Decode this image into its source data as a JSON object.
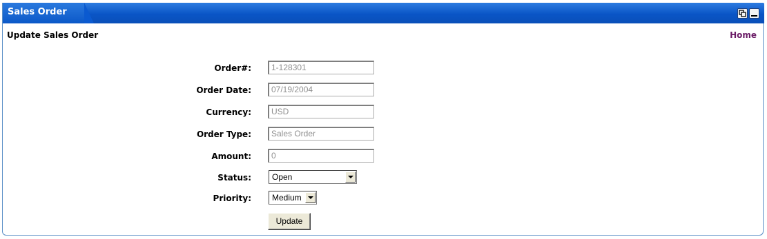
{
  "portlet": {
    "title": "Sales Order",
    "subtitle": "Update Sales Order",
    "home_link": "Home"
  },
  "form": {
    "order_number": {
      "label": "Order#:",
      "value": "1-128301"
    },
    "order_date": {
      "label": "Order Date:",
      "value": "07/19/2004"
    },
    "currency": {
      "label": "Currency:",
      "value": "USD"
    },
    "order_type": {
      "label": "Order Type:",
      "value": "Sales Order"
    },
    "amount": {
      "label": "Amount:",
      "value": "0"
    },
    "status": {
      "label": "Status:",
      "selected": "Open"
    },
    "priority": {
      "label": "Priority:",
      "selected": "Medium"
    },
    "update_label": "Update"
  },
  "icons": {
    "restore": "restore-window-icon",
    "minimize": "minimize-window-icon"
  },
  "colors": {
    "titlebar": "#0a55c6",
    "link": "#6a1b66",
    "border": "#5b8fc7"
  }
}
